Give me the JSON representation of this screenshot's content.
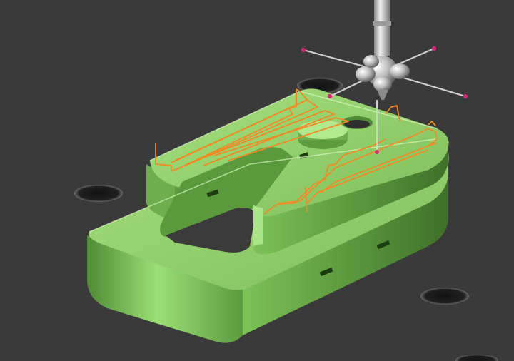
{
  "viewport": {
    "background_color": "#3a3a3a",
    "part_color": "#8fd06a",
    "part_shadow_color": "#3d6b2a",
    "toolpath_color": "#f08a24",
    "stylus_tip_color": "#d6247a",
    "probe_color": "#c9c9c9",
    "hole_color": "#1c1c1c"
  },
  "scene": {
    "part": "green-fixture-plate-with-slot",
    "probe": "cmm-star-probe",
    "toolpath": "orange-zigzag-scan-path",
    "mounting_holes": 4
  }
}
